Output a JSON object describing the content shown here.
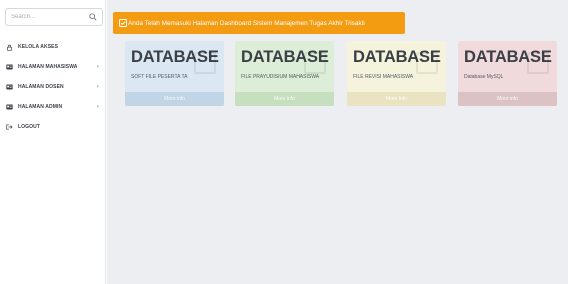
{
  "search": {
    "placeholder": "Search..."
  },
  "sidebar": {
    "items": [
      {
        "label": "KELOLA AKSES",
        "icon": "lock-icon",
        "has_submenu": false
      },
      {
        "label": "HALAMAN MAHASISWA",
        "icon": "id-card-icon",
        "has_submenu": true
      },
      {
        "label": "HALAMAN DOSEN",
        "icon": "id-card-icon",
        "has_submenu": true
      },
      {
        "label": "HALAMAN ADMIN",
        "icon": "id-card-icon",
        "has_submenu": true
      },
      {
        "label": "LOGOUT",
        "icon": "logout-icon",
        "has_submenu": false
      }
    ],
    "chevron": "‹"
  },
  "alert": {
    "text": "Anda Telah Memasuki Halaman Dashboard Sistem Manajemen Tugas Akhir Trisakti",
    "color": "#f39c12"
  },
  "boxes": [
    {
      "title": "DATABASE",
      "subtitle": "SOFT FILE PESERTA TA",
      "footer": "More info",
      "color": "#dbe8f3"
    },
    {
      "title": "DATABASE",
      "subtitle": "FILE PRAYUDISIUM MAHASISWA",
      "footer": "More info",
      "color": "#dceed7"
    },
    {
      "title": "DATABASE",
      "subtitle": "FILE REVISI MAHASISWA",
      "footer": "More info",
      "color": "#f6f3dd"
    },
    {
      "title": "DATABASE",
      "subtitle": "Database MySQL",
      "footer": "More info",
      "color": "#f1dadb"
    }
  ]
}
